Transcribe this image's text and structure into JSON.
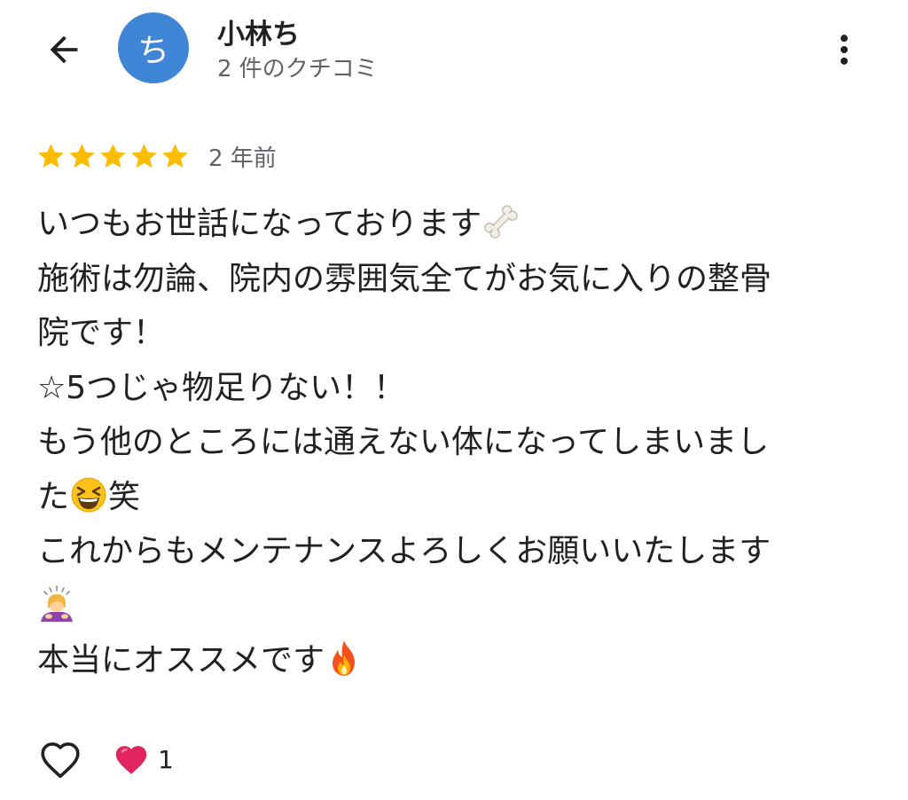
{
  "header": {
    "avatar_letter": "ち",
    "user_name": "小林ち",
    "review_count": "2 件のクチコミ"
  },
  "review": {
    "rating": 5,
    "max_rating": 5,
    "date": "2 年前",
    "lines": [
      "いつもお世話になっております",
      "施術は勿論、院内の雰囲気全てがお気に入りの整骨",
      "院です！",
      "☆5つじゃ物足りない！！",
      "もう他のところには通えない体になってしまいまし",
      "た",
      "笑",
      "これからもメンテナンスよろしくお願いいたします",
      "本当にオススメです"
    ]
  },
  "reactions": {
    "like_count": "1"
  },
  "icons": {
    "back": "arrow-back-icon",
    "more": "more-vertical-icon",
    "star": "star-icon",
    "like": "heart-outline-icon",
    "reaction": "red-heart-icon"
  },
  "colors": {
    "avatar": "#3f86d6",
    "star": "#fbbc04",
    "heart": "#e0245e",
    "text": "#202124",
    "secondary_text": "#5f6368"
  }
}
